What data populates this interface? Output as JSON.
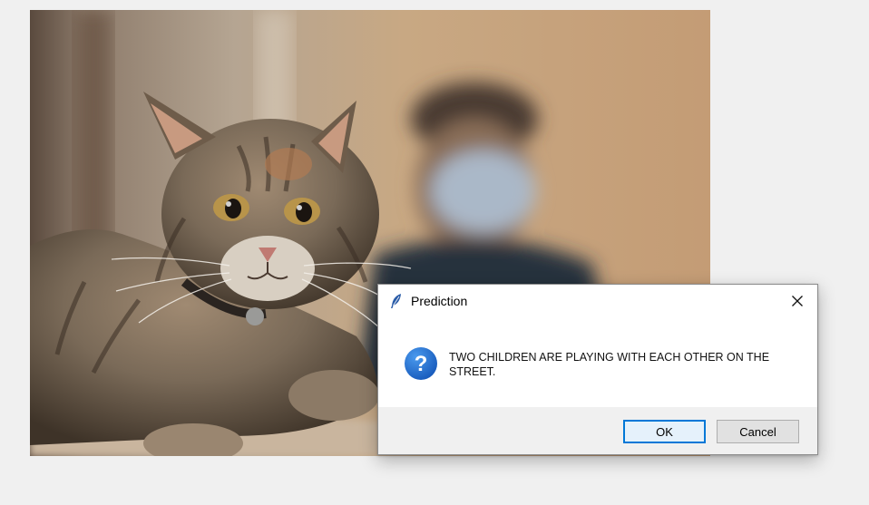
{
  "dialog": {
    "title": "Prediction",
    "message": "TWO CHILDREN ARE PLAYING WITH EACH OTHER ON THE STREET.",
    "ok_label": "OK",
    "cancel_label": "Cancel",
    "icons": {
      "app": "feather-icon",
      "close": "close-icon",
      "message": "question-icon"
    }
  },
  "colors": {
    "dialog_bg": "#ffffff",
    "footer_bg": "#f0f0f0",
    "ok_border": "#0078d7",
    "question_icon": "#1a6fd0"
  }
}
